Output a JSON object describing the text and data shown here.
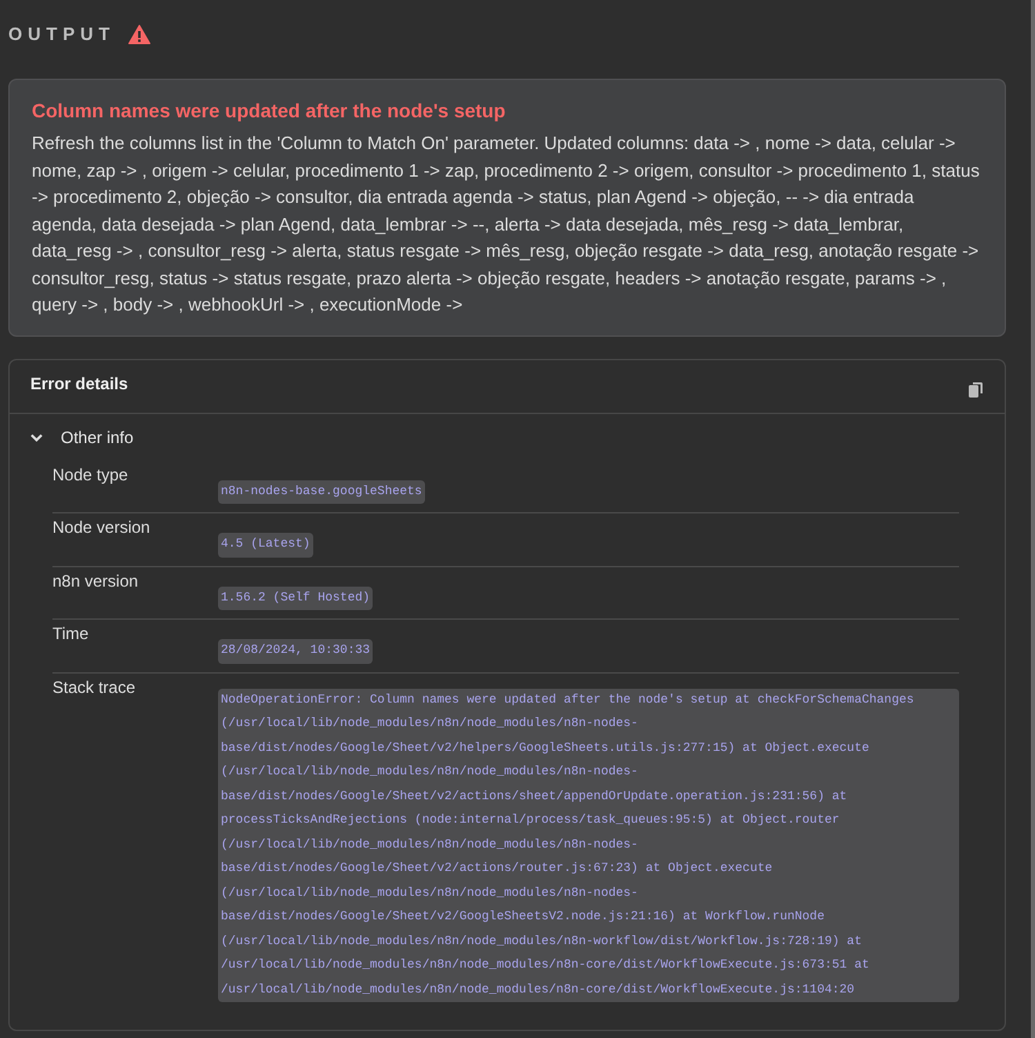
{
  "header": {
    "title": "OUTPUT"
  },
  "error": {
    "title": "Column names were updated after the node's setup",
    "message": "Refresh the columns list in the 'Column to Match On' parameter. Updated columns: data -> , nome -> data, celular -> nome, zap -> , origem -> celular, procedimento 1 -> zap, procedimento 2 -> origem, consultor -> procedimento 1, status -> procedimento 2, objeção -> consultor, dia entrada agenda -> status, plan Agend -> objeção, -- -> dia entrada agenda, data desejada -> plan Agend, data_lembrar -> --, alerta -> data desejada, mês_resg -> data_lembrar, data_resg -> , consultor_resg -> alerta, status resgate -> mês_resg, objeção resgate -> data_resg, anotação resgate -> consultor_resg, status -> status resgate, prazo alerta -> objeção resgate, headers -> anotação resgate, params -> , query -> , body -> , webhookUrl -> , executionMode ->"
  },
  "details": {
    "title": "Error details",
    "section": {
      "label": "Other info",
      "expanded": true
    },
    "rows": [
      {
        "label": "Node type",
        "value": "n8n-nodes-base.googleSheets"
      },
      {
        "label": "Node version",
        "value": "4.5 (Latest)"
      },
      {
        "label": "n8n version",
        "value": "1.56.2 (Self Hosted)"
      },
      {
        "label": "Time",
        "value": "28/08/2024, 10:30:33"
      },
      {
        "label": "Stack trace",
        "value": "NodeOperationError: Column names were updated after the node's setup at checkForSchemaChanges (/usr/local/lib/node_modules/n8n/node_modules/n8n-nodes-base/dist/nodes/Google/Sheet/v2/helpers/GoogleSheets.utils.js:277:15) at Object.execute (/usr/local/lib/node_modules/n8n/node_modules/n8n-nodes-base/dist/nodes/Google/Sheet/v2/actions/sheet/appendOrUpdate.operation.js:231:56) at processTicksAndRejections (node:internal/process/task_queues:95:5) at Object.router (/usr/local/lib/node_modules/n8n/node_modules/n8n-nodes-base/dist/nodes/Google/Sheet/v2/actions/router.js:67:23) at Object.execute (/usr/local/lib/node_modules/n8n/node_modules/n8n-nodes-base/dist/nodes/Google/Sheet/v2/GoogleSheetsV2.node.js:21:16) at Workflow.runNode (/usr/local/lib/node_modules/n8n/node_modules/n8n-workflow/dist/Workflow.js:728:19) at /usr/local/lib/node_modules/n8n/node_modules/n8n-core/dist/WorkflowExecute.js:673:51 at /usr/local/lib/node_modules/n8n/node_modules/n8n-core/dist/WorkflowExecute.js:1104:20"
      }
    ]
  }
}
